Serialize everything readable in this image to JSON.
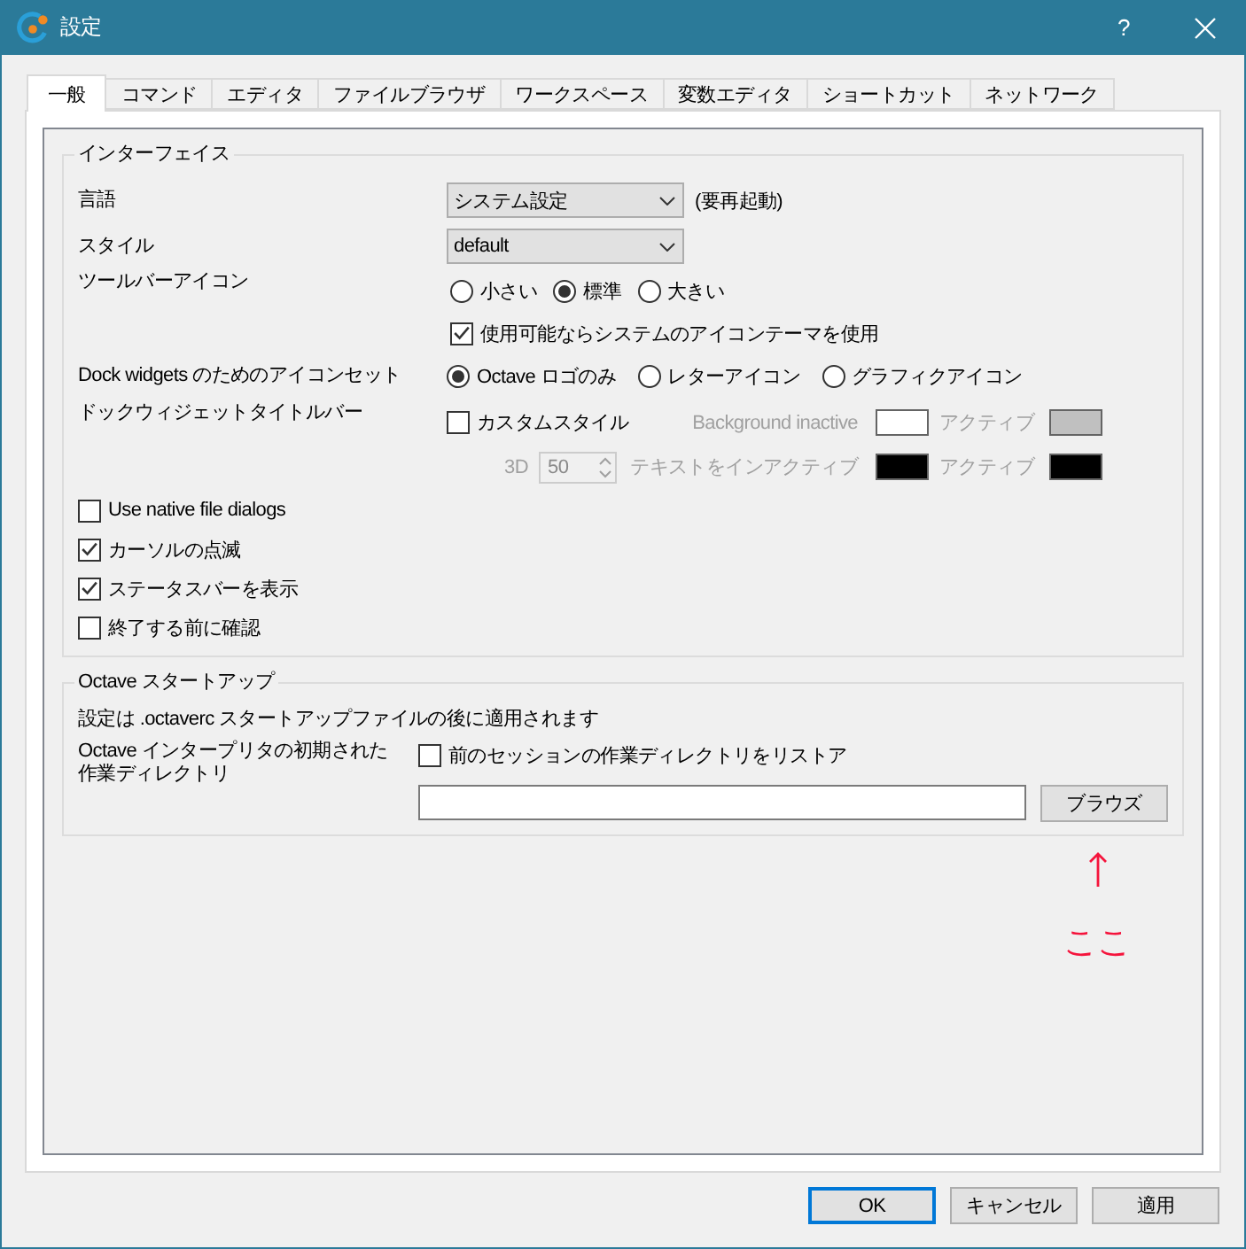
{
  "window": {
    "title": "設定",
    "help_button": "?"
  },
  "tabs": [
    {
      "label": "一般",
      "selected": true
    },
    {
      "label": "コマンド",
      "selected": false
    },
    {
      "label": "エディタ",
      "selected": false
    },
    {
      "label": "ファイルブラウザ",
      "selected": false
    },
    {
      "label": "ワークスペース",
      "selected": false
    },
    {
      "label": "変数エディタ",
      "selected": false
    },
    {
      "label": "ショートカット",
      "selected": false
    },
    {
      "label": "ネットワーク",
      "selected": false
    }
  ],
  "interface": {
    "title": "インターフェイス",
    "language": {
      "label": "言語",
      "value": "システム設定",
      "note": "(要再起動)"
    },
    "style": {
      "label": "スタイル",
      "value": "default"
    },
    "toolbar_icons": {
      "label": "ツールバーアイコン",
      "options": [
        {
          "label": "小さい",
          "selected": false
        },
        {
          "label": "標準",
          "selected": true
        },
        {
          "label": "大きい",
          "selected": false
        }
      ]
    },
    "system_icon_theme": {
      "label": "使用可能ならシステムのアイコンテーマを使用",
      "checked": true
    },
    "dock_icon_set": {
      "label": "Dock widgets のためのアイコンセット",
      "options": [
        {
          "label": "Octave ロゴのみ",
          "selected": true
        },
        {
          "label": "レターアイコン",
          "selected": false
        },
        {
          "label": "グラフィクアイコン",
          "selected": false
        }
      ]
    },
    "dock_title_bar": {
      "label": "ドックウィジェットタイトルバー",
      "disabled": true,
      "custom_style": {
        "label": "カスタムスタイル",
        "checked": false
      },
      "depth": {
        "label": "3D",
        "value": "50"
      },
      "colors": [
        {
          "label": "Background inactive",
          "color": "#ffffff"
        },
        {
          "label": "アクティブ",
          "color": "#c0c0c0"
        },
        {
          "label": "テキストをインアクティブ",
          "color": "#000000"
        },
        {
          "label": "アクティブ",
          "color": "#000000"
        }
      ]
    },
    "checkboxes": [
      {
        "label": "Use native file dialogs",
        "checked": false
      },
      {
        "label": "カーソルの点滅",
        "checked": true
      },
      {
        "label": "ステータスバーを表示",
        "checked": true
      },
      {
        "label": "終了する前に確認",
        "checked": false
      }
    ]
  },
  "startup": {
    "title": "Octave スタートアップ",
    "note": "設定は .octaverc スタートアップファイルの後に適用されます",
    "directory_label": "Octave インタープリタの初期された作業ディレクトリ",
    "restore_previous": {
      "label": "前のセッションの作業ディレクトリをリストア",
      "checked": false
    },
    "browse_button": "ブラウズ"
  },
  "annotation": {
    "text": "ここ"
  },
  "buttons": [
    {
      "label": "OK",
      "focused": true
    },
    {
      "label": "キャンセル",
      "focused": false
    },
    {
      "label": "適用",
      "focused": false
    }
  ]
}
